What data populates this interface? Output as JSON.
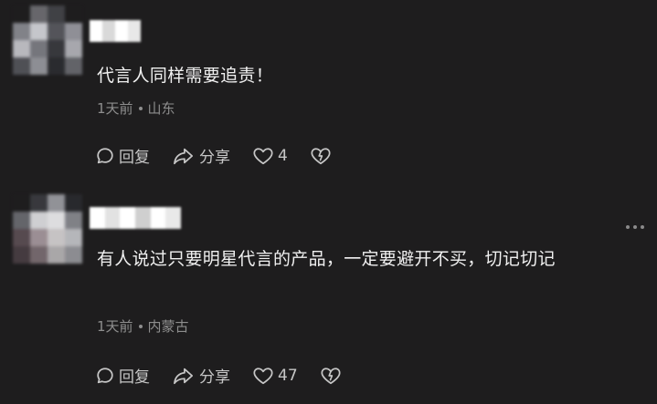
{
  "comments": [
    {
      "text": "代言人同样需要追责！",
      "time": "1天前",
      "location": "山东",
      "reply_label": "回复",
      "share_label": "分享",
      "like_count": "4",
      "icons": [
        "reply-icon",
        "share-icon",
        "like-icon",
        "unlike-icon"
      ]
    },
    {
      "text": "有人说过只要明星代言的产品，一定要避开不买，切记切记",
      "time": "1天前",
      "location": "内蒙古",
      "reply_label": "回复",
      "share_label": "分享",
      "like_count": "47",
      "icons": [
        "more-icon",
        "reply-icon",
        "share-icon",
        "like-icon",
        "unlike-icon"
      ]
    }
  ],
  "colors": {
    "background": "#1e1d1e",
    "text": "#f0f0f0",
    "meta": "#8e8e8e",
    "action": "#c6c6c6"
  }
}
